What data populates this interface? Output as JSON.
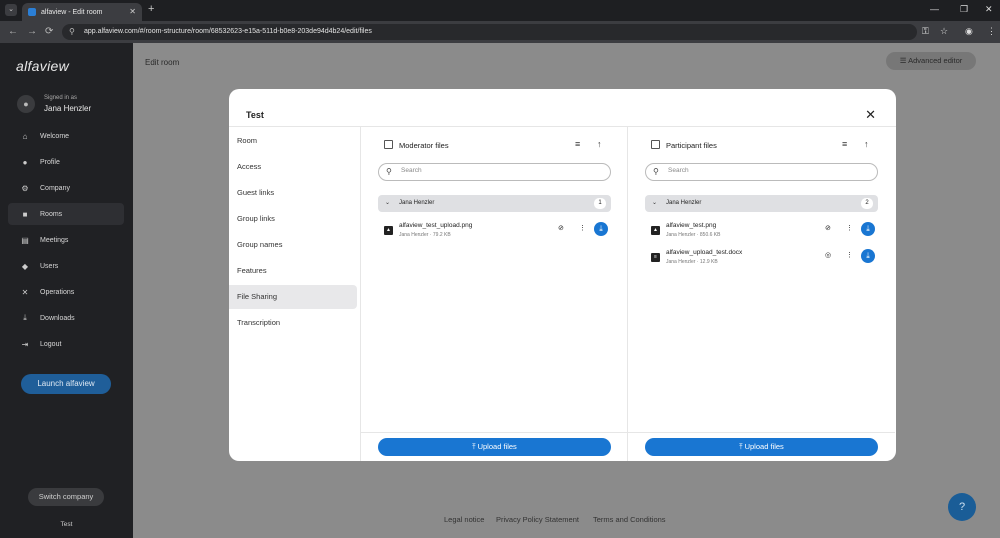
{
  "browser": {
    "tab_title": "alfaview - Edit room",
    "tab_close": "✕",
    "new_tab": "+",
    "url": "app.alfaview.com/#/room-structure/room/68532623-e15a-511d-b0e8-203de94d4b24/edit/files",
    "nav": {
      "back": "←",
      "forward": "→",
      "reload": "⟳"
    }
  },
  "sidebar": {
    "brand": "alfaview",
    "signed_in_label": "Signed in as",
    "user_name": "Jana Henzler",
    "items": [
      {
        "label": "Welcome",
        "icon": "home-icon",
        "glyph": "⌂"
      },
      {
        "label": "Profile",
        "icon": "person-icon",
        "glyph": "●"
      },
      {
        "label": "Company",
        "icon": "gear-icon",
        "glyph": "⚙"
      },
      {
        "label": "Rooms",
        "icon": "folder-icon",
        "glyph": "■"
      },
      {
        "label": "Meetings",
        "icon": "calendar-icon",
        "glyph": "▤"
      },
      {
        "label": "Users",
        "icon": "group-icon",
        "glyph": "◆"
      },
      {
        "label": "Operations",
        "icon": "tools-icon",
        "glyph": "✕"
      },
      {
        "label": "Downloads",
        "icon": "download-icon",
        "glyph": "⤓"
      },
      {
        "label": "Logout",
        "icon": "logout-icon",
        "glyph": "⇥"
      }
    ],
    "active_item": "Rooms",
    "launch_button": "Launch alfaview",
    "switch_company": "Switch company",
    "company_name": "Test"
  },
  "main": {
    "page_title": "Edit room",
    "advanced_editor": "Advanced editor",
    "footer_links": [
      "Legal notice",
      "Privacy Policy Statement",
      "Terms and Conditions"
    ],
    "help_glyph": "?"
  },
  "modal": {
    "title": "Test",
    "close_glyph": "✕",
    "nav_items": [
      "Room",
      "Access",
      "Guest links",
      "Group links",
      "Group names",
      "Features",
      "File Sharing",
      "Transcription"
    ],
    "active_nav": "File Sharing",
    "panes": [
      {
        "title": "Moderator files",
        "search_placeholder": "Search",
        "group_name": "Jana Henzler",
        "group_count": "1",
        "files": [
          {
            "name": "alfaview_test_upload.png",
            "meta": "Jana Henzler · 79.2 KB",
            "type_icon": "image-icon",
            "visibility_icon": "visibility-off-icon"
          }
        ],
        "upload_label": "Upload files"
      },
      {
        "title": "Participant files",
        "search_placeholder": "Search",
        "group_name": "Jana Henzler",
        "group_count": "2",
        "files": [
          {
            "name": "alfaview_test.png",
            "meta": "Jana Henzler · 850.6 KB",
            "type_icon": "image-icon",
            "visibility_icon": "visibility-off-icon"
          },
          {
            "name": "alfaview_upload_test.docx",
            "meta": "Jana Henzler · 12.9 KB",
            "type_icon": "document-icon",
            "visibility_icon": "eye-off-icon"
          }
        ],
        "upload_label": "Upload files"
      }
    ]
  },
  "colors": {
    "accent": "#1976d2",
    "sidebar_bg": "#202124",
    "launch": "#1f5e99"
  }
}
